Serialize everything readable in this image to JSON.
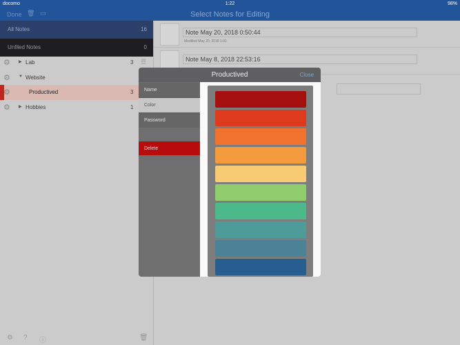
{
  "status": {
    "carrier": "docomo",
    "time": "1:22",
    "battery": "98%"
  },
  "nav": {
    "done": "Done",
    "title": "Select Notes for Editing"
  },
  "sidebar": {
    "all_notes": {
      "label": "All Notes",
      "count": "16"
    },
    "unfiled": {
      "label": "Unfiled Notes",
      "count": "0"
    },
    "folders": [
      {
        "name": "Lab",
        "count": "3"
      },
      {
        "name": "Website",
        "count": ""
      },
      {
        "name": "Productived",
        "count": "3"
      },
      {
        "name": "Hobbies",
        "count": "1"
      }
    ]
  },
  "notes": [
    {
      "title": "Note May 20, 2018 0:50:44",
      "modified": "Modified May 20, 2018 1:01"
    },
    {
      "title": "Note May 8, 2018 22:53:16",
      "modified": ""
    }
  ],
  "modal": {
    "title": "Productived",
    "close": "Close",
    "menu": {
      "name": "Name",
      "color": "Color",
      "password": "Password",
      "delete": "Delete"
    },
    "swatches": [
      "#a50f0d",
      "#de3a1d",
      "#f0722c",
      "#f39a3c",
      "#f6cb73",
      "#8fcd6d",
      "#4cb98a",
      "#4d9c99",
      "#4c8296",
      "#275e8f"
    ]
  }
}
